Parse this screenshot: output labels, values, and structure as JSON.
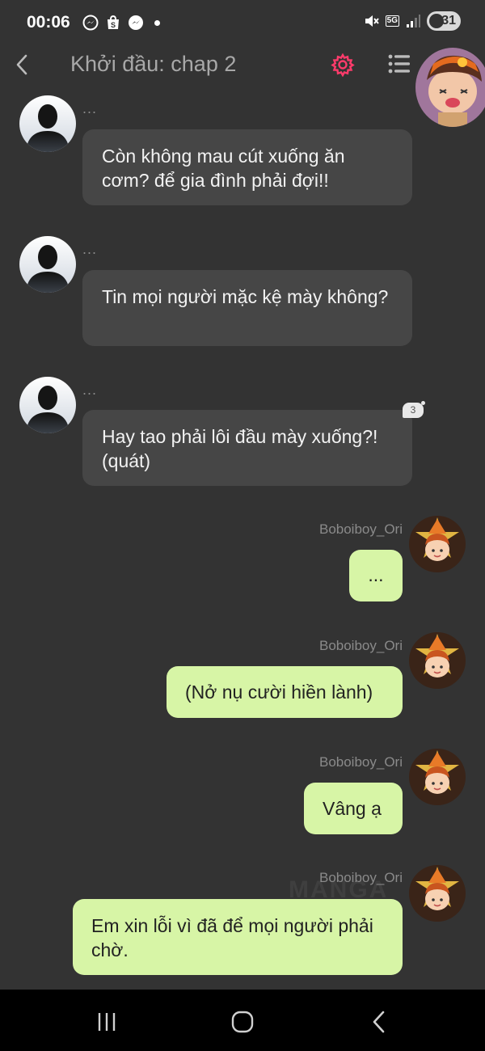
{
  "status_bar": {
    "time": "00:06",
    "left_icons": [
      "messenger-icon",
      "shopee-bag-icon",
      "messenger-icon"
    ],
    "network_label": "5G",
    "battery_level": "31"
  },
  "header": {
    "title": "Khởi đầu: chap 2",
    "accent_color": "#ff3b6b"
  },
  "messages": [
    {
      "side": "left",
      "sender": "...",
      "text": "Còn không mau cút xuống ăn cơm? để gia đình phải đợi!!"
    },
    {
      "side": "left",
      "sender": "...",
      "text": "Tin mọi người mặc kệ mày không?"
    },
    {
      "side": "left",
      "sender": "...",
      "text": "Hay tao phải lôi đầu mày xuống?! (quát)",
      "comment_count": "3"
    },
    {
      "side": "right",
      "sender": "Boboiboy_Ori",
      "text": "..."
    },
    {
      "side": "right",
      "sender": "Boboiboy_Ori",
      "text": "(Nở nụ cười hiền lành)"
    },
    {
      "side": "right",
      "sender": "Boboiboy_Ori",
      "text": "Vâng ạ"
    },
    {
      "side": "right",
      "sender": "Boboiboy_Ori",
      "text": "Em xin lỗi vì đã để mọi người phải chờ."
    }
  ],
  "watermark": "MANGA",
  "colors": {
    "background": "#333333",
    "bubble_left": "#464646",
    "bubble_right": "#d7f5a6"
  }
}
